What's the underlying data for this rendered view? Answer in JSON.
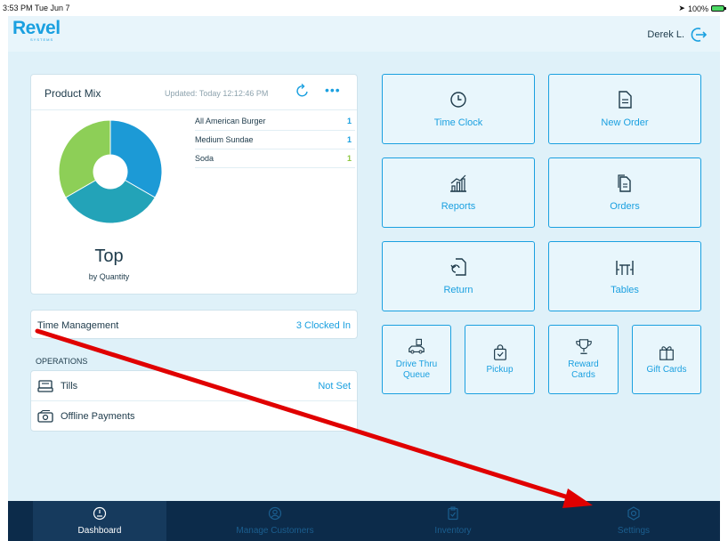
{
  "status_bar": {
    "time": "3:53 PM  Tue Jun 7",
    "battery": "100%"
  },
  "header": {
    "logo_text": "Revel",
    "logo_sub": "SYSTEMS",
    "user_name": "Derek L."
  },
  "product_mix": {
    "title": "Product Mix",
    "updated": "Updated: Today 12:12:46 PM",
    "more": "•••",
    "items": [
      {
        "name": "All American Burger",
        "qty": "1"
      },
      {
        "name": "Medium Sundae",
        "qty": "1"
      },
      {
        "name": "Soda",
        "qty": "1"
      }
    ],
    "mode": "Top",
    "by": "by Quantity",
    "chart_colors": [
      "#1c9ad6",
      "#23a3b8",
      "#8dcf57"
    ]
  },
  "time_management": {
    "label": "Time Management",
    "value": "3 Clocked In"
  },
  "operations": {
    "heading": "OPERATIONS",
    "items": [
      {
        "label": "Tills",
        "value": "Not Set",
        "icon": "register-icon"
      },
      {
        "label": "Offline Payments",
        "value": "",
        "icon": "cash-icon"
      }
    ]
  },
  "tiles": {
    "time_clock": "Time Clock",
    "new_order": "New Order",
    "reports": "Reports",
    "orders": "Orders",
    "return": "Return",
    "tables": "Tables",
    "drive_thru_1": "Drive Thru",
    "drive_thru_2": "Queue",
    "pickup": "Pickup",
    "reward_1": "Reward",
    "reward_2": "Cards",
    "gift_cards": "Gift Cards"
  },
  "tabbar": {
    "dashboard": "Dashboard",
    "manage_customers": "Manage Customers",
    "inventory": "Inventory",
    "settings": "Settings"
  },
  "colors": {
    "accent": "#1aa0e0",
    "annotation_arrow": "#e00000",
    "tabbar": "#0c2b4a"
  }
}
